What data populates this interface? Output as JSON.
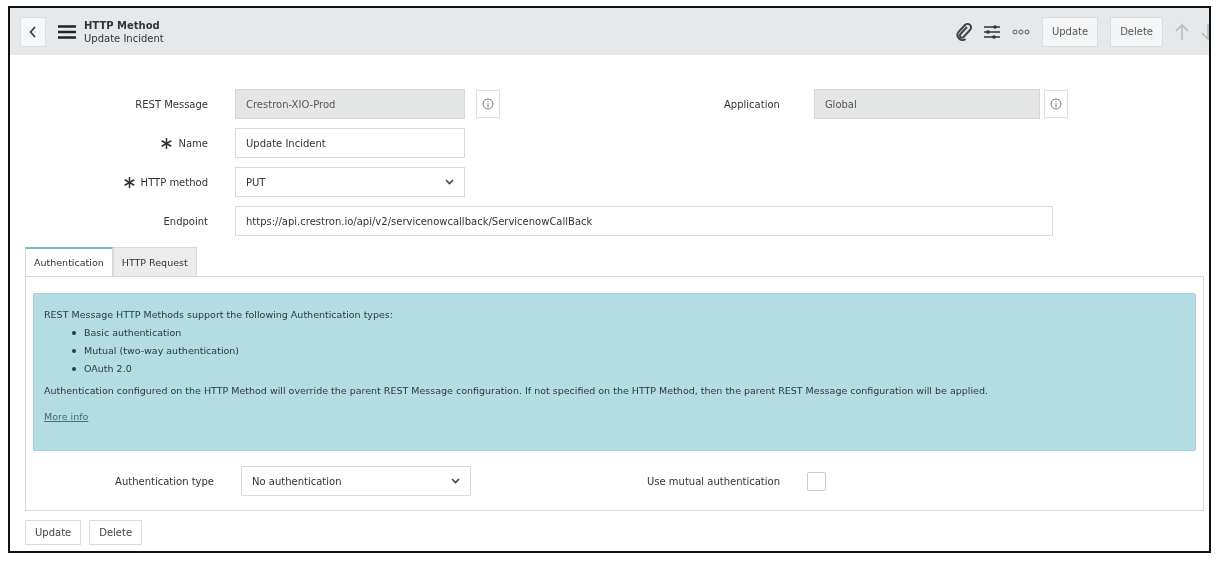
{
  "header": {
    "title": "HTTP Method",
    "subtitle": "Update Incident",
    "buttons": [
      "Update",
      "Delete"
    ]
  },
  "fields": [
    {
      "label": "REST Message",
      "value": "Crestron-XIO-Prod",
      "kind": "readonly",
      "required": false
    },
    {
      "label": "Name",
      "value": "Update Incident",
      "kind": "text",
      "required": true
    },
    {
      "label": "HTTP method",
      "value": "PUT",
      "kind": "select",
      "required": true
    },
    {
      "label": "Endpoint",
      "value": "https://api.crestron.io/api/v2/servicenowcallback/ServicenowCallBack",
      "kind": "wide",
      "required": false
    }
  ],
  "side_field": {
    "label": "Application",
    "value": "Global"
  },
  "tabs": [
    {
      "label": "Authentication",
      "selected": true
    },
    {
      "label": "HTTP Request",
      "selected": false
    }
  ],
  "info_box": {
    "intro": "REST Message HTTP Methods support the following Authentication types:",
    "items": [
      "Basic authentication",
      "Mutual (two-way authentication)",
      "OAuth 2.0"
    ],
    "note": "Authentication configured on the HTTP Method will override the parent REST Message configuration. If not specified on the HTTP Method, then the parent REST Message configuration will be applied.",
    "link": "More info"
  },
  "auth_type": {
    "label": "Authentication type",
    "value": "No authentication"
  },
  "mutual": {
    "label": "Use mutual authentication",
    "checked": false
  },
  "footer_buttons": [
    "Update",
    "Delete"
  ]
}
